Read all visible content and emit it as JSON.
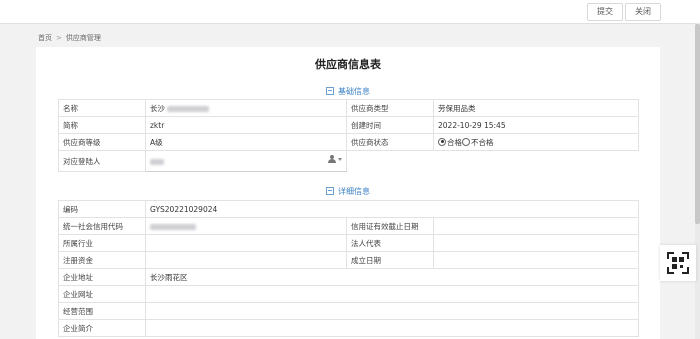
{
  "toolbar": {
    "submit_label": "提交",
    "close_label": "关闭"
  },
  "breadcrumb": {
    "home": "首页",
    "sep": ">",
    "current": "供应商管理"
  },
  "page": {
    "title": "供应商信息表"
  },
  "basic": {
    "heading": "基础信息",
    "name_label": "名称",
    "name_value": "长沙",
    "type_label": "供应商类型",
    "type_value": "劳保用品类",
    "short_label": "简称",
    "short_value": "zktr",
    "created_label": "创建时间",
    "created_value": "2022-10-29 15:45",
    "level_label": "供应商等级",
    "level_value": "A级",
    "status_label": "供应商状态",
    "status_ok": "合格",
    "status_bad": "不合格",
    "login_label": "对应登陆人"
  },
  "detail": {
    "heading": "详细信息",
    "code_label": "编码",
    "code_value": "GYS20221029024",
    "credit_label": "统一社会信用代码",
    "expire_label": "信用证有效截止日期",
    "industry_label": "所属行业",
    "legal_label": "法人代表",
    "capital_label": "注册资金",
    "founded_label": "成立日期",
    "address_label": "企业地址",
    "address_value": "长沙雨花区",
    "website_label": "企业网址",
    "scope_label": "经营范围",
    "intro_label": "企业简介"
  },
  "icons": {
    "collapse": "collapse-icon",
    "user": "user-icon",
    "qr": "qr-scan-icon"
  },
  "colors": {
    "accent": "#3b82c4"
  }
}
